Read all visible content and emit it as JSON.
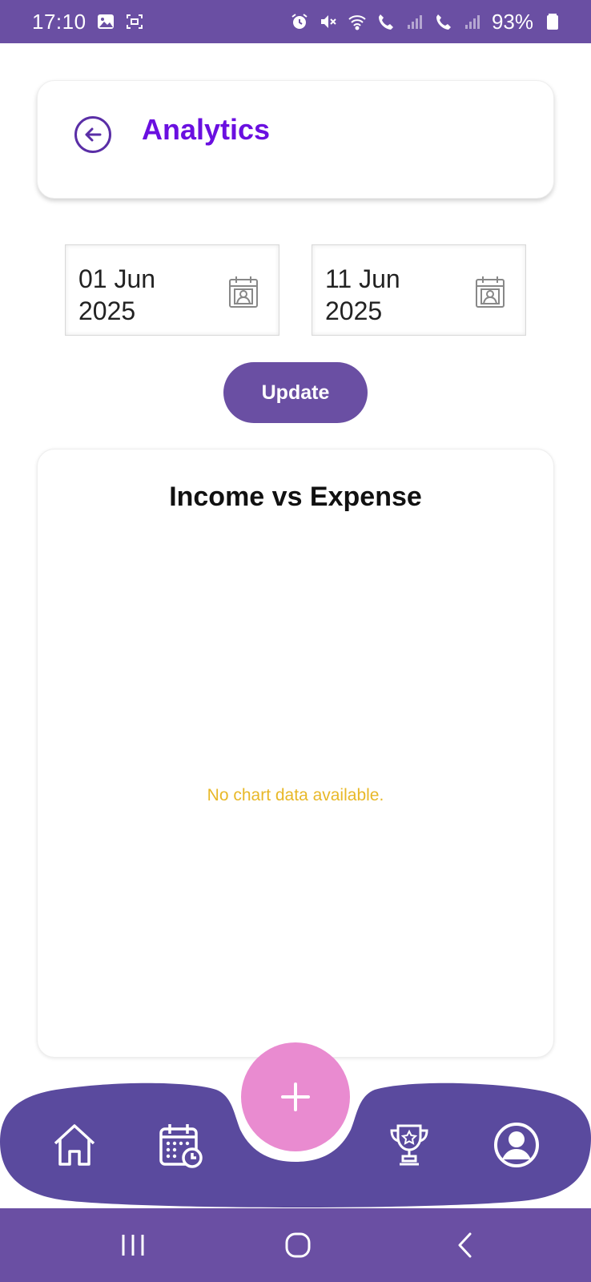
{
  "status_bar": {
    "time": "17:10",
    "battery": "93%",
    "icons": [
      "gallery-icon",
      "screen-capture-icon",
      "alarm-icon",
      "mute-icon",
      "wifi-icon",
      "wifi-call-1-icon",
      "signal-1-icon",
      "wifi-call-2-icon",
      "signal-2-icon",
      "battery-icon"
    ]
  },
  "header": {
    "title": "Analytics",
    "back_icon": "back-arrow-icon"
  },
  "date_range": {
    "start": "01 Jun 2025",
    "end": "11 Jun 2025",
    "picker_icon": "calendar-icon"
  },
  "update_button": {
    "label": "Update"
  },
  "chart": {
    "title": "Income vs Expense",
    "empty_message": "No chart data available."
  },
  "bottom_nav": {
    "items": [
      {
        "icon": "home-icon"
      },
      {
        "icon": "calendar-schedule-icon"
      },
      {
        "icon": "add-icon"
      },
      {
        "icon": "trophy-icon"
      },
      {
        "icon": "profile-icon"
      }
    ]
  },
  "system_nav": {
    "icons": [
      "recent-apps-icon",
      "home-button-icon",
      "back-icon"
    ]
  },
  "colors": {
    "primary": "#6a4fa3",
    "title_accent": "#6a0fe0",
    "fab": "#e98bd0",
    "empty_message": "#e8b828",
    "nav_bar": "#5a4a9e"
  }
}
